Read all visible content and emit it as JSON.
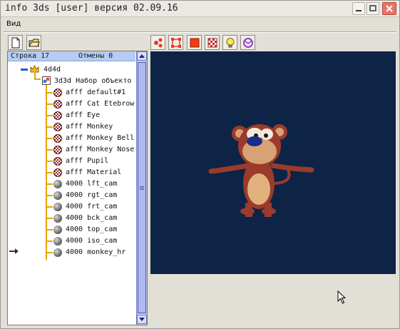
{
  "window": {
    "title": "info 3ds [user] версия 02.09.16"
  },
  "menu": {
    "view": "Вид"
  },
  "colors": {
    "viewport_bg": "#0d2446",
    "panel_status_bg": "#b7ccf2",
    "tree_line": "#e0a800",
    "scrollbar": "#c6cef4"
  },
  "toolbar_left": [
    {
      "icon": "new-document-icon"
    },
    {
      "icon": "open-folder-icon"
    }
  ],
  "toolbar_right": [
    {
      "icon": "nodes-icon"
    },
    {
      "icon": "bounding-box-icon"
    },
    {
      "icon": "solid-fill-icon"
    },
    {
      "icon": "texture-checker-icon"
    },
    {
      "icon": "light-bulb-icon"
    },
    {
      "icon": "rotate-icon"
    }
  ],
  "panel": {
    "status_line": "Строка 17",
    "undo": "Отмены 0"
  },
  "tree": {
    "root": "4d4d",
    "scene": "3d3d Набор объекто",
    "items": [
      {
        "label": "afff default#1",
        "icon": "material-icon"
      },
      {
        "label": "afff Cat Etebrow",
        "icon": "material-icon"
      },
      {
        "label": "afff Eye",
        "icon": "material-icon"
      },
      {
        "label": "afff Monkey",
        "icon": "material-icon"
      },
      {
        "label": "afff Monkey Bell",
        "icon": "material-icon"
      },
      {
        "label": "afff Monkey Nose",
        "icon": "material-icon"
      },
      {
        "label": "afff Pupil",
        "icon": "material-icon"
      },
      {
        "label": "afff Material",
        "icon": "material-icon"
      },
      {
        "label": "4000 lft_cam",
        "icon": "object-icon"
      },
      {
        "label": "4000 rgt_cam",
        "icon": "object-icon"
      },
      {
        "label": "4000 frt_cam",
        "icon": "object-icon"
      },
      {
        "label": "4000 bck_cam",
        "icon": "object-icon"
      },
      {
        "label": "4000 top_cam",
        "icon": "object-icon"
      },
      {
        "label": "4000 iso_cam",
        "icon": "object-icon"
      },
      {
        "label": "4000 monkey_hr",
        "icon": "object-icon"
      }
    ]
  }
}
